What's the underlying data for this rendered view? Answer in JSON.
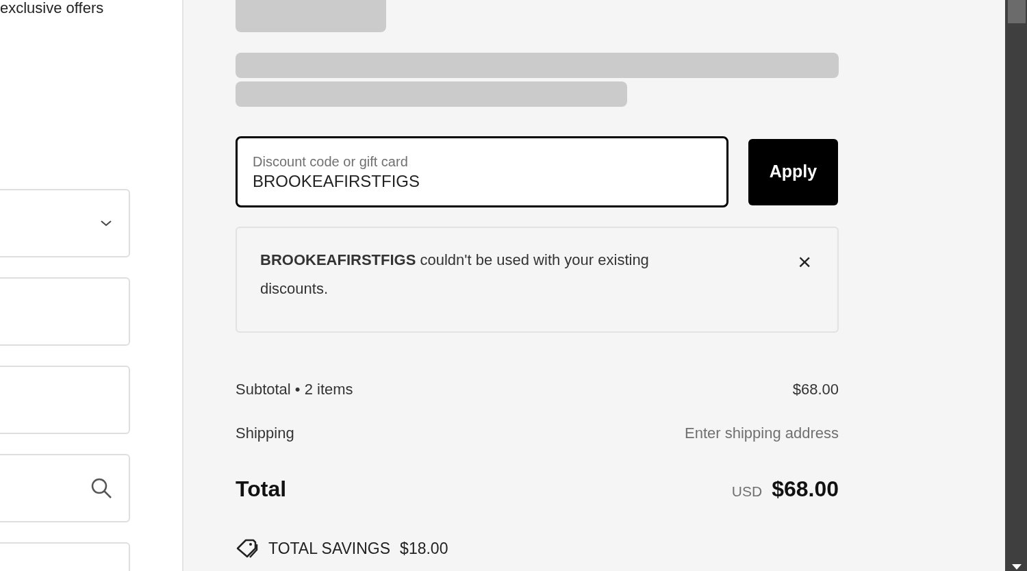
{
  "left_panel": {
    "text": "exclusive offers",
    "fields": [
      {
        "kind": "select"
      },
      {
        "kind": "text"
      },
      {
        "kind": "text"
      },
      {
        "kind": "search"
      },
      {
        "kind": "text"
      }
    ]
  },
  "discount": {
    "label": "Discount code or gift card",
    "value": "BROOKEAFIRSTFIGS",
    "button": "Apply"
  },
  "notice": {
    "message": "**BROOKEAFIRSTFIGS** couldn't be used with your existing discounts.",
    "close": "×"
  },
  "summary": {
    "rows": [
      {
        "label": "Subtotal • 2 items",
        "value": "$68.00",
        "kind": "amount"
      },
      {
        "label": "Shipping",
        "value": "Enter shipping address",
        "kind": "hint"
      }
    ],
    "total": {
      "label": "Total",
      "currency": "USD",
      "value": "$68.00"
    },
    "savings": {
      "label": "TOTAL SAVINGS",
      "value": "$18.00"
    }
  }
}
